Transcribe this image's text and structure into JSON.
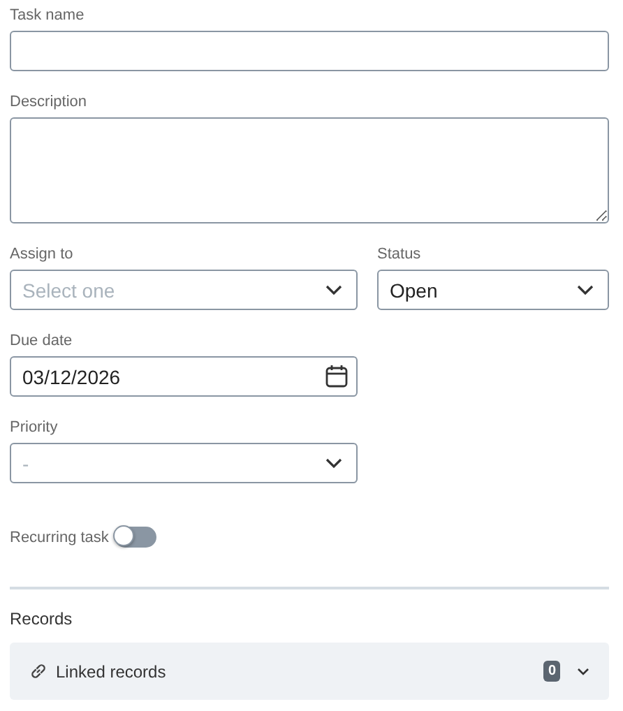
{
  "rows": [
    [
      {
        "kind": "text",
        "label": "Task name"
      }
    ],
    [
      {
        "kind": "textarea",
        "label": "Description"
      }
    ],
    [
      {
        "kind": "select",
        "label": "Assign to",
        "placeholder": "Select one"
      },
      {
        "kind": "select",
        "label": "Status",
        "value": "Open"
      }
    ],
    [
      {
        "kind": "date",
        "label": "Due date",
        "value": "03/12/2026"
      }
    ],
    [
      {
        "kind": "select",
        "label": "Priority",
        "placeholder": "-"
      }
    ]
  ],
  "recurring": {
    "label": "Recurring task",
    "on": false
  },
  "records": {
    "title": "Records",
    "linked": {
      "label": "Linked records",
      "count": "0"
    }
  }
}
